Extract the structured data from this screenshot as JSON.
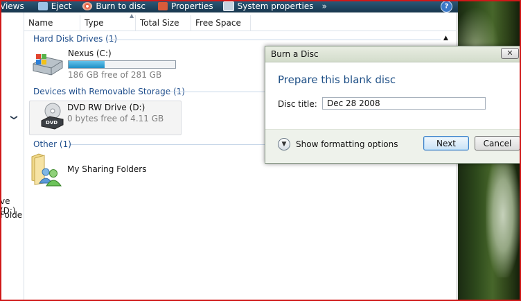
{
  "toolbar": {
    "views": "Views",
    "eject": "Eject",
    "burn": "Burn to disc",
    "properties": "Properties",
    "system_properties": "System properties",
    "more": "»",
    "help": "?"
  },
  "columns": [
    "Name",
    "Type",
    "Total Size",
    "Free Space"
  ],
  "nav": {
    "chevron": "❯",
    "item1": "ve (D:)",
    "item2": "Folde"
  },
  "groups": {
    "hdd": "Hard Disk Drives (1)",
    "removable": "Devices with Removable Storage (1)",
    "other": "Other (1)"
  },
  "drives": {
    "nexus": {
      "name": "Nexus (C:)",
      "free": "186 GB free of 281 GB",
      "used_fraction": 0.34
    },
    "dvd": {
      "name": "DVD RW Drive (D:)",
      "free": "0 bytes free of 4.11 GB",
      "icon_text": "DVD"
    }
  },
  "other": {
    "name": "My Sharing Folders"
  },
  "dialog": {
    "title": "Burn a Disc",
    "close": "✕",
    "heading": "Prepare this blank disc",
    "disc_title_label": "Disc title:",
    "disc_title_value": "Dec 28 2008",
    "show_formatting": "Show formatting options",
    "next": "Next",
    "cancel": "Cancel"
  },
  "colors": {
    "group_text": "#1f4e8c",
    "progress": "#2a9ad4",
    "toolbar": "#1f4461"
  }
}
